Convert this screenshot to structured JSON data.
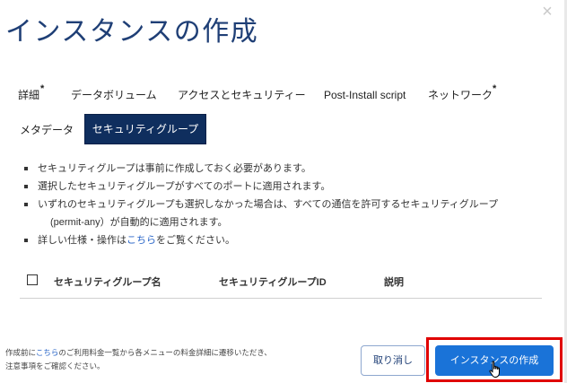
{
  "modal": {
    "title": "インスタンスの作成",
    "close_icon": "×"
  },
  "tabs": [
    {
      "label": "詳細",
      "required": true,
      "req_mark": "*"
    },
    {
      "label": "データボリューム",
      "required": false
    },
    {
      "label": "アクセスとセキュリティー",
      "required": false
    },
    {
      "label": "Post-Install script",
      "required": false
    },
    {
      "label": "ネットワーク",
      "required": true,
      "req_mark": "*"
    },
    {
      "label": "メタデータ",
      "required": false
    },
    {
      "label": "セキュリティグループ",
      "active": true
    }
  ],
  "notes": [
    "セキュリティグループは事前に作成しておく必要があります。",
    "選択したセキュリティグループがすべてのポートに適用されます。",
    "いずれのセキュリティグループも選択しなかった場合は、すべての通信を許可するセキュリティグループ",
    "(permit-any）が自動的に適用されます。",
    "詳しい仕様・操作は",
    "こちら",
    "をご覧ください。"
  ],
  "table": {
    "columns": [
      "セキュリティグループ名",
      "セキュリティグループID",
      "説明"
    ]
  },
  "footer": {
    "note_prefix": "作成前に",
    "note_link": "こちら",
    "note_rest": "のご利用料金一覧から各メニューの料金詳細に遷移いただき、",
    "note_line2": "注意事項をご確認ください。",
    "cancel_label": "取り消し",
    "create_label": "インスタンスの作成"
  },
  "colors": {
    "title": "#1f3f76",
    "active_tab": "#0f2e5e",
    "primary_button": "#1a73d8",
    "highlight": "#e00000",
    "link": "#2a66c8"
  }
}
